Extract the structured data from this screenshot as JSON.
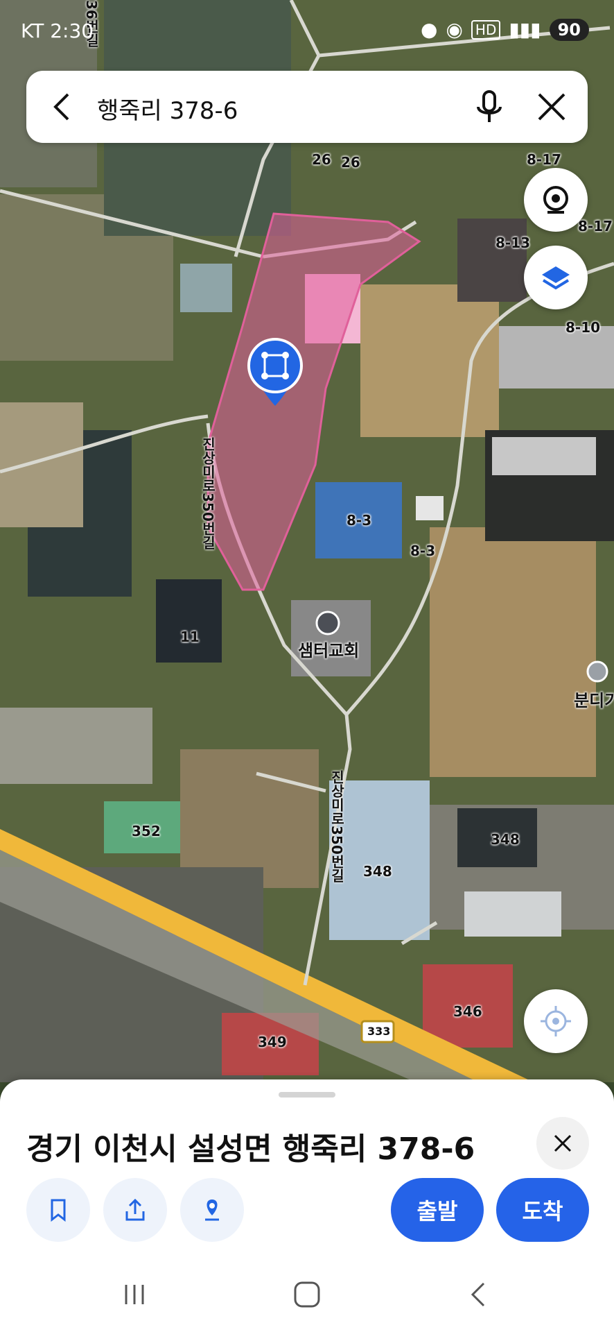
{
  "status_bar": {
    "carrier": "KT 2:30",
    "battery": "90"
  },
  "search": {
    "query": "행죽리 378-6"
  },
  "map": {
    "building_labels": [
      "26",
      "26",
      "8-17",
      "8-17",
      "8-13",
      "8-10",
      "8-3",
      "8-3",
      "11",
      "352",
      "348",
      "348",
      "346",
      "349"
    ],
    "road_labels": [
      "진상미로350번길",
      "진상미로350번길",
      "36번길"
    ],
    "poi_church": "샘터교회",
    "poi_edge": "분디기",
    "route_shield": "333"
  },
  "sheet": {
    "address": "경기 이천시 설성면 행죽리 378-6",
    "depart_label": "출발",
    "arrive_label": "도착"
  },
  "colors": {
    "accent": "#2563e8",
    "parcel": "#e0609a"
  }
}
